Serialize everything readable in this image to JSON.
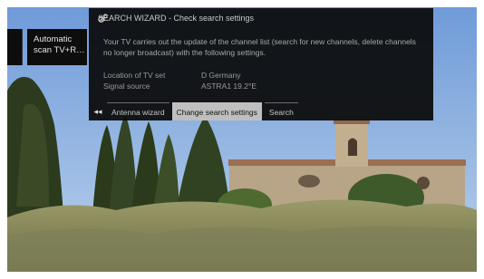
{
  "sidebar": {
    "tile_line1": "Automatic",
    "tile_line2": "scan TV+R…"
  },
  "wizard": {
    "icon": "gears-icon",
    "title": "SEARCH WIZARD - Check search settings",
    "description": "Your TV carries out the update of the channel list (search for new channels, delete channels no longer broadcast) with the following settings.",
    "settings": [
      {
        "label": "Location of TV set",
        "value": "D Germany"
      },
      {
        "label": "Signal source",
        "value": "ASTRA1 19.2°E"
      }
    ],
    "nav": {
      "back_icon": "double-left-arrow-icon",
      "back_glyph": "◂◂",
      "items": [
        {
          "label": "Antenna wizard",
          "active": false
        },
        {
          "label": "Change search settings",
          "active": true
        },
        {
          "label": "Search",
          "active": false
        }
      ]
    }
  }
}
